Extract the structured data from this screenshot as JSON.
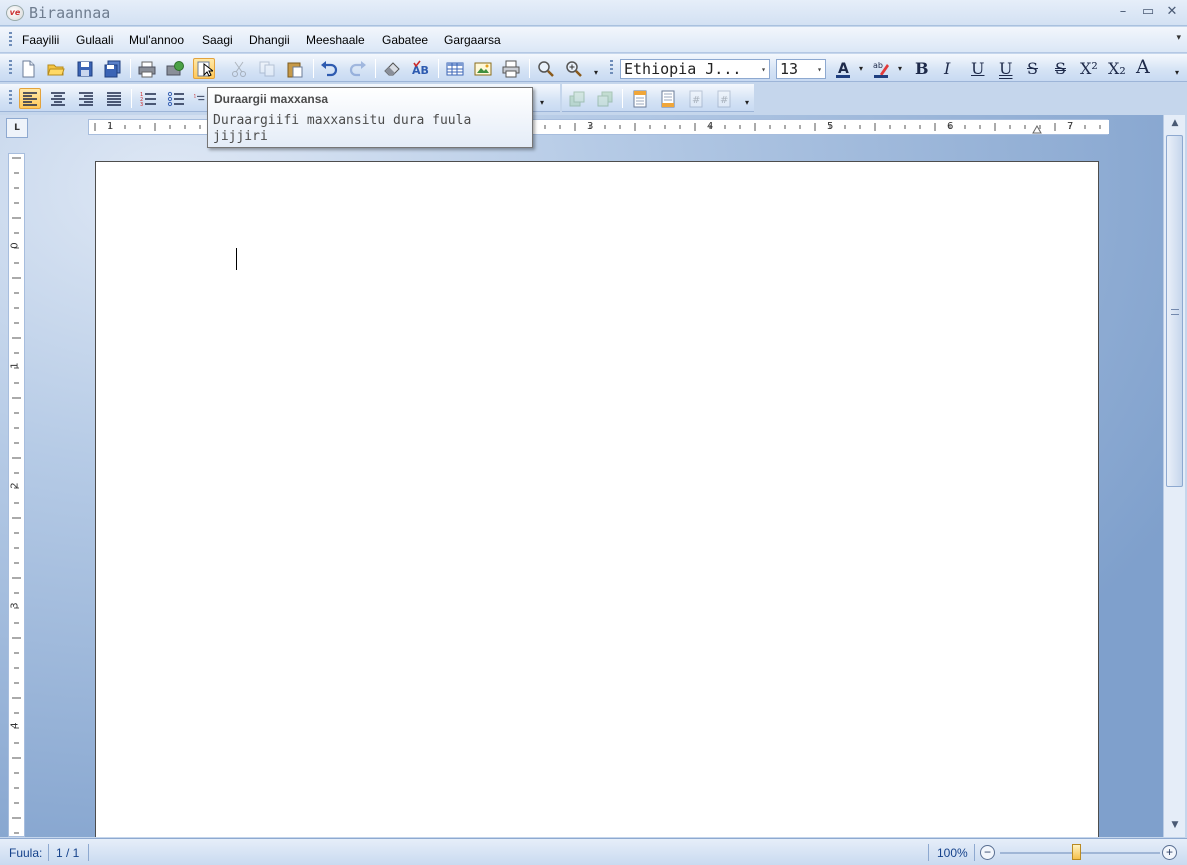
{
  "window": {
    "title": "Biraannaa",
    "logo_text": "ve",
    "controls": {
      "minimize": "–",
      "maximize": "▭",
      "close": "✕"
    }
  },
  "menu": {
    "items": [
      "Faayilii",
      "Gulaali",
      "Mul'annoo",
      "Saagi",
      "Dhangii",
      "Meeshaale",
      "Gabatee",
      "Gargaarsa"
    ]
  },
  "format_toolbar": {
    "font_name": "Ethiopia J...",
    "font_size": "13",
    "bold": "B",
    "italic": "I",
    "underline": "U",
    "double_underline": "U",
    "strike": "S",
    "double_strike": "S",
    "superscript": "X²",
    "subscript": "X₂",
    "font_grow": "A"
  },
  "tooltip": {
    "title": "Duraargii maxxansa",
    "body": "Duraargiifi maxxansitu dura fuula jijjiri"
  },
  "ruler": {
    "corner": "L",
    "h_numbers": [
      "1",
      "3",
      "4",
      "5",
      "6",
      "7"
    ],
    "v_numbers": [
      "0",
      "1",
      "2",
      "3",
      "4"
    ]
  },
  "status": {
    "page_label": "Fuula:",
    "page_value": "1 / 1",
    "zoom_level": "100%",
    "zoom_fraction": 0.55
  },
  "colors": {
    "accent": "#15428b",
    "active_button": "#ffc95a"
  }
}
